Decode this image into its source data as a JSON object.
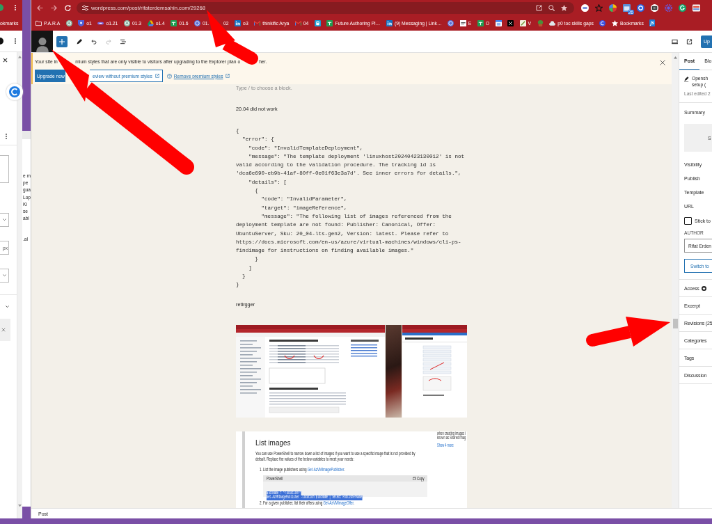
{
  "side_window": {
    "bookmarks_label": "okmarks",
    "unit": "px",
    "text_fragments": [
      "e m",
      "pe",
      "gua",
      "Lop",
      "Ki",
      "se",
      "abl"
    ],
    "lower_fragment": ".al"
  },
  "browser": {
    "url": "wordpress.com/post/rifaterdemsahin.com/29268",
    "extension_badge": "26",
    "bookmarks": [
      {
        "kind": "folder",
        "label": "P.A.R.A"
      },
      {
        "kind": "knot"
      },
      {
        "kind": "shield",
        "label": "o1"
      },
      {
        "kind": "dash",
        "label": "o1.21"
      },
      {
        "kind": "knot",
        "label": "01.3"
      },
      {
        "kind": "triangle",
        "label": "o1.4"
      },
      {
        "kind": "sheet",
        "label": "01.6"
      },
      {
        "kind": "ring",
        "label": "01."
      },
      {
        "label": "02"
      },
      {
        "kind": "linked",
        "label": "o3"
      },
      {
        "kind": "mail",
        "label": "thinkific Arya"
      },
      {
        "kind": "mail",
        "label": "04"
      },
      {
        "kind": "tile"
      },
      {
        "kind": "sheet",
        "label": "Future Authoring Pl…"
      },
      {
        "kind": "linked",
        "label": "(9) Messaging | Link…"
      },
      {
        "kind": "ring"
      },
      {
        "kind": "page",
        "label": "E"
      },
      {
        "kind": "sheet",
        "label": "O"
      },
      {
        "kind": "calendar"
      },
      {
        "kind": "cross"
      },
      {
        "kind": "note",
        "label": "V"
      },
      {
        "kind": "plant"
      },
      {
        "kind": "cloud",
        "label": "p0 toc skills gaps"
      },
      {
        "kind": "disc"
      },
      {
        "kind": "star",
        "label": "Bookmarks"
      },
      {
        "kind": "code",
        "badge": "js"
      }
    ]
  },
  "editor": {
    "history": {
      "undo_disabled": false,
      "redo_disabled": true
    },
    "save_label": "Up",
    "notice": {
      "text_parts": [
        "Your site in",
        "mium styles that are only visible to visitors after upgrading to the Explorer plan o",
        "her."
      ],
      "primary_button": "Upgrade now",
      "secondary_button": "eview without premium styles",
      "link": "Remove premium styles"
    },
    "placeholder": "Type / to choose a block.",
    "blocks": [
      {
        "kind": "paragraph",
        "text": "20.04 did not work"
      },
      {
        "kind": "code",
        "lines": [
          "{",
          "  \"error\": {",
          "    \"code\": \"InvalidTemplateDeployment\",",
          "    \"message\": \"The template deployment 'linuxhost20240423130012' is not",
          "valid according to the validation procedure. The tracking id is",
          "'dca6e690-eb9b-41af-80ff-0e01f63e3a7d'. See inner errors for details.\",",
          "    \"details\": [",
          "      {",
          "        \"code\": \"InvalidParameter\",",
          "        \"target\": \"imageReference\",",
          "        \"message\": \"The following list of images referenced from the",
          "deployment template are not found: Publisher: Canonical, Offer:",
          "UbuntuServer, Sku: 20_04-lts-gen2, Version: latest. Please refer to",
          "https://docs.microsoft.com/en-us/azure/virtual-machines/windows/cli-ps-",
          "findimage for instructions on finding available images.\"",
          "      }",
          "    ]",
          "  }",
          "}"
        ]
      },
      {
        "kind": "paragraph",
        "text": "retirgger"
      },
      {
        "kind": "gallery"
      },
      {
        "kind": "document",
        "heading": "List images",
        "intro_lines": [
          "You can use PowerShell to narrow down a list of images if you want to use a specific image that is not provided by",
          "default. Replace the values of the below variables to meet your needs:"
        ],
        "steps": [
          {
            "text": "1. List the image publishers using ",
            "link": "Get-AzVMImagePublisher",
            "after": "."
          },
          {
            "text": "2. For a given publisher, list their offers using ",
            "link": "Get-AzVMImageOffer",
            "after": "."
          }
        ],
        "code_title": "PowerShell",
        "copy_label": "Copy",
        "code_lines": [
          "$locName = \"<location>\"",
          "Get-AzVMImagePublisher -Location $locName | Select PublisherName"
        ],
        "aside_lines": [
          "when creating images i",
          "known as Shared Imag"
        ],
        "aside_link": "Show 4 more"
      }
    ],
    "breadcrumb": "Post"
  },
  "sidebar": {
    "tabs": [
      {
        "label": "Post",
        "selected": true
      },
      {
        "label": "Blo",
        "selected": false
      }
    ],
    "title_lines": [
      "Opensh",
      "setup ("
    ],
    "last_edited": "Last edited 2",
    "summary": "Summary",
    "featured_image": "S",
    "rows": [
      "Visibility",
      "Publish",
      "Template",
      "URL"
    ],
    "sticky": {
      "label": "Stick to",
      "checked": false
    },
    "author_heading": "AUTHOR",
    "author": "Rifat Erden",
    "switch_button": "Switch to",
    "panels": [
      {
        "kind": "premium",
        "label": "Access"
      },
      {
        "kind": "plain",
        "label": "Excerpt"
      },
      {
        "kind": "plain",
        "label": "Revisions (25"
      },
      {
        "kind": "plain",
        "label": "Categories"
      },
      {
        "kind": "plain",
        "label": "Tags"
      },
      {
        "kind": "plain",
        "label": "Discussion"
      }
    ]
  }
}
